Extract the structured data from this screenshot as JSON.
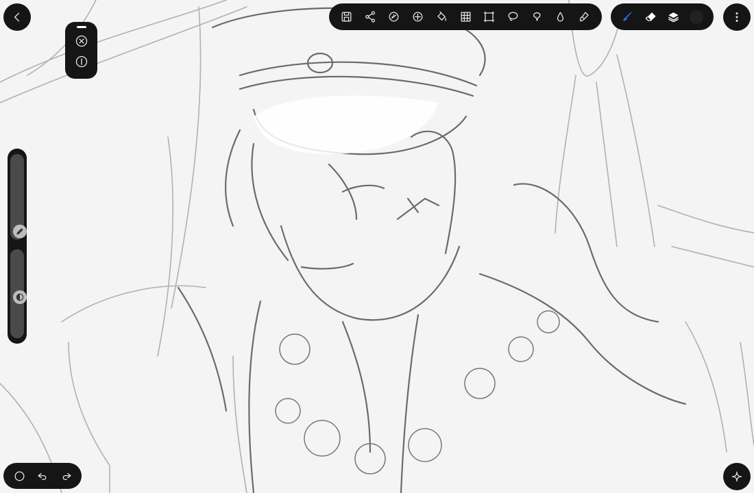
{
  "app": {
    "accent_color": "#2a6bd6",
    "panel_color": "#151515"
  },
  "toolbar": {
    "tools": [
      {
        "id": "save",
        "icon": "save-icon"
      },
      {
        "id": "share",
        "icon": "share-icon"
      },
      {
        "id": "adjust",
        "icon": "adjust-icon"
      },
      {
        "id": "transform",
        "icon": "transform-icon"
      },
      {
        "id": "fill",
        "icon": "paint-bucket-icon"
      },
      {
        "id": "grid",
        "icon": "grid-icon"
      },
      {
        "id": "select-rect",
        "icon": "rectangle-select-icon"
      },
      {
        "id": "lasso",
        "icon": "lasso-icon"
      },
      {
        "id": "liquify",
        "icon": "liquify-icon"
      },
      {
        "id": "blend",
        "icon": "drop-icon"
      },
      {
        "id": "smudge",
        "icon": "smudge-icon"
      }
    ],
    "brush_tools": [
      {
        "id": "brush",
        "icon": "brush-icon",
        "active": true
      },
      {
        "id": "eraser",
        "icon": "eraser-icon"
      },
      {
        "id": "layers",
        "icon": "layers-icon"
      },
      {
        "id": "color",
        "icon": "color-swatch",
        "value": "#222222"
      }
    ]
  },
  "quick_panel": {
    "buttons": [
      "close-icon",
      "info-icon"
    ]
  },
  "side_slider": {
    "size_level": 1.0,
    "opacity_level": 0.55,
    "size_icon": "pencil-icon",
    "opacity_icon": "opacity-icon"
  },
  "history": {
    "buttons": [
      "circle-icon",
      "undo-icon",
      "redo-icon"
    ]
  }
}
